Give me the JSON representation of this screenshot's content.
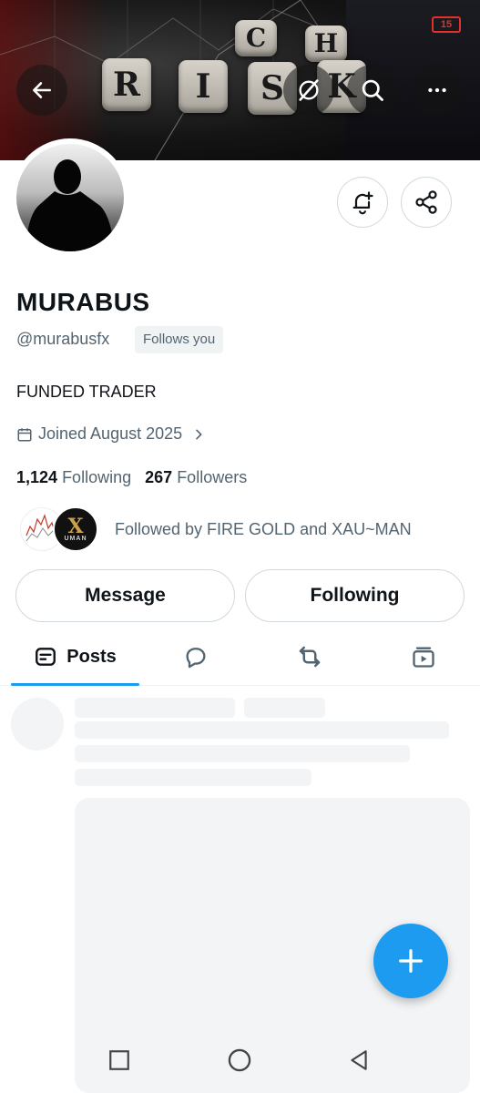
{
  "banner": {
    "tiles_top": [
      "C",
      "H"
    ],
    "tiles_bottom": [
      "R",
      "I",
      "S",
      "K"
    ],
    "battery_level": "15"
  },
  "header_icons": {
    "back": "arrow-left-icon",
    "grok": "grok-icon",
    "search": "search-icon",
    "more": "more-icon"
  },
  "profile": {
    "name": "MURABUS",
    "handle": "@murabusfx",
    "follows_you": "Follows you",
    "bio": "FUNDED TRADER",
    "joined": "Joined August 2025",
    "following_count": "1,124",
    "following_label": "Following",
    "followers_count": "267",
    "followers_label": "Followers",
    "followed_by": "Followed by FIRE GOLD and XAU~MAN"
  },
  "mutual_avatars": {
    "second_text": "X",
    "second_sub": "UMAN"
  },
  "actions": {
    "message": "Message",
    "following": "Following"
  },
  "tabs": {
    "posts": "Posts"
  },
  "colors": {
    "accent": "#1d9bf0",
    "text": "#0f1419",
    "secondary": "#536471",
    "border": "#cfd9de"
  }
}
